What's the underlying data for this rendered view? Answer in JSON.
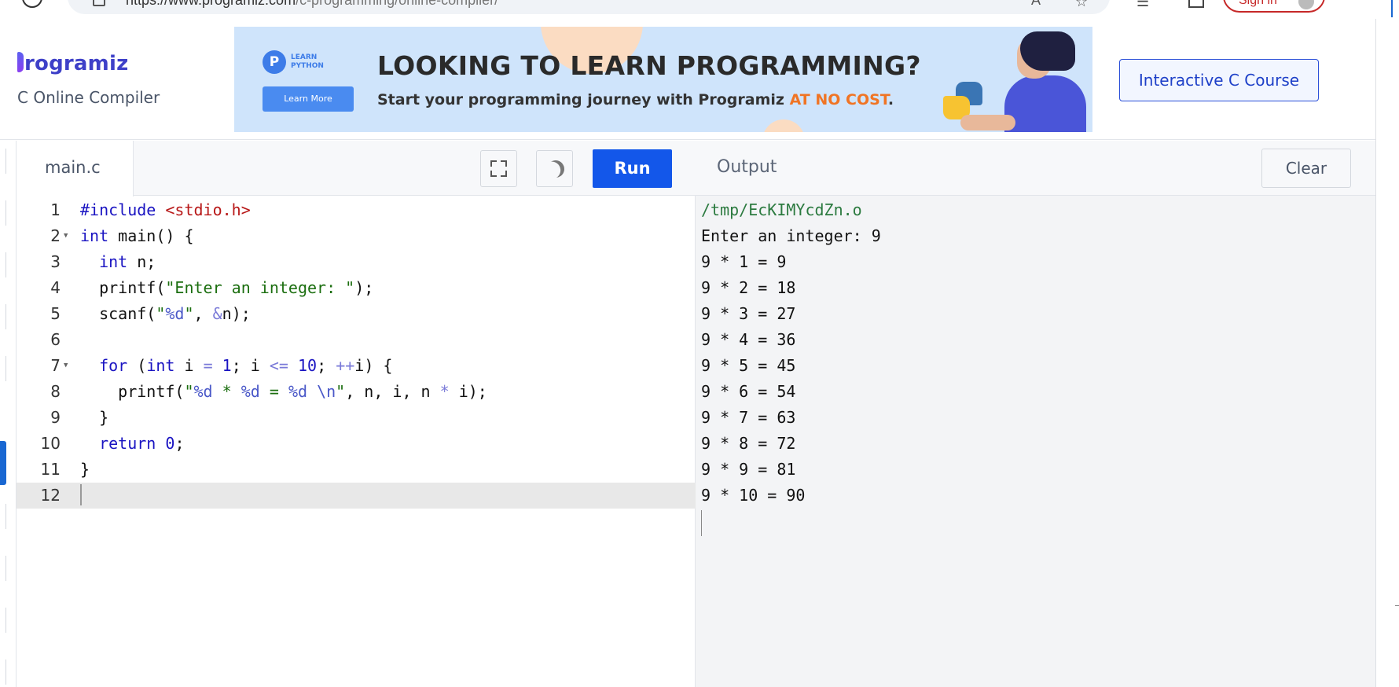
{
  "browser": {
    "url_host": "https://www.programiz.com",
    "url_path": "/c-programming/online-compiler/",
    "signin_label": "Sign in"
  },
  "header": {
    "logo_text": "rogramiz",
    "subtitle": "C Online Compiler",
    "course_button": "Interactive C Course"
  },
  "banner": {
    "badge_letter": "P",
    "badge_text": "LEARN PYTHON",
    "learn_more": "Learn More",
    "title": "LOOKING TO LEARN PROGRAMMING?",
    "subtitle_prefix": "Start your programming journey with Programiz ",
    "subtitle_highlight": "AT NO COST",
    "subtitle_suffix": "."
  },
  "editor": {
    "tab_label": "main.c",
    "run_label": "Run",
    "line_numbers": [
      "1",
      "2",
      "3",
      "4",
      "5",
      "6",
      "7",
      "8",
      "9",
      "10",
      "11",
      "12"
    ]
  },
  "output": {
    "title": "Output",
    "clear_label": "Clear",
    "lines": [
      "/tmp/EcKIMYcdZn.o",
      "Enter an integer: 9",
      "9 * 1 = 9",
      "9 * 2 = 18",
      "9 * 3 = 27",
      "9 * 4 = 36",
      "9 * 5 = 45",
      "9 * 6 = 54",
      "9 * 7 = 63",
      "9 * 8 = 72",
      "9 * 9 = 81",
      "9 * 10 = 90"
    ]
  },
  "colors": {
    "accent": "#1357ea",
    "course_border": "#2b4fd8",
    "highlight": "#f07424",
    "output_path": "#2b7a3f"
  }
}
